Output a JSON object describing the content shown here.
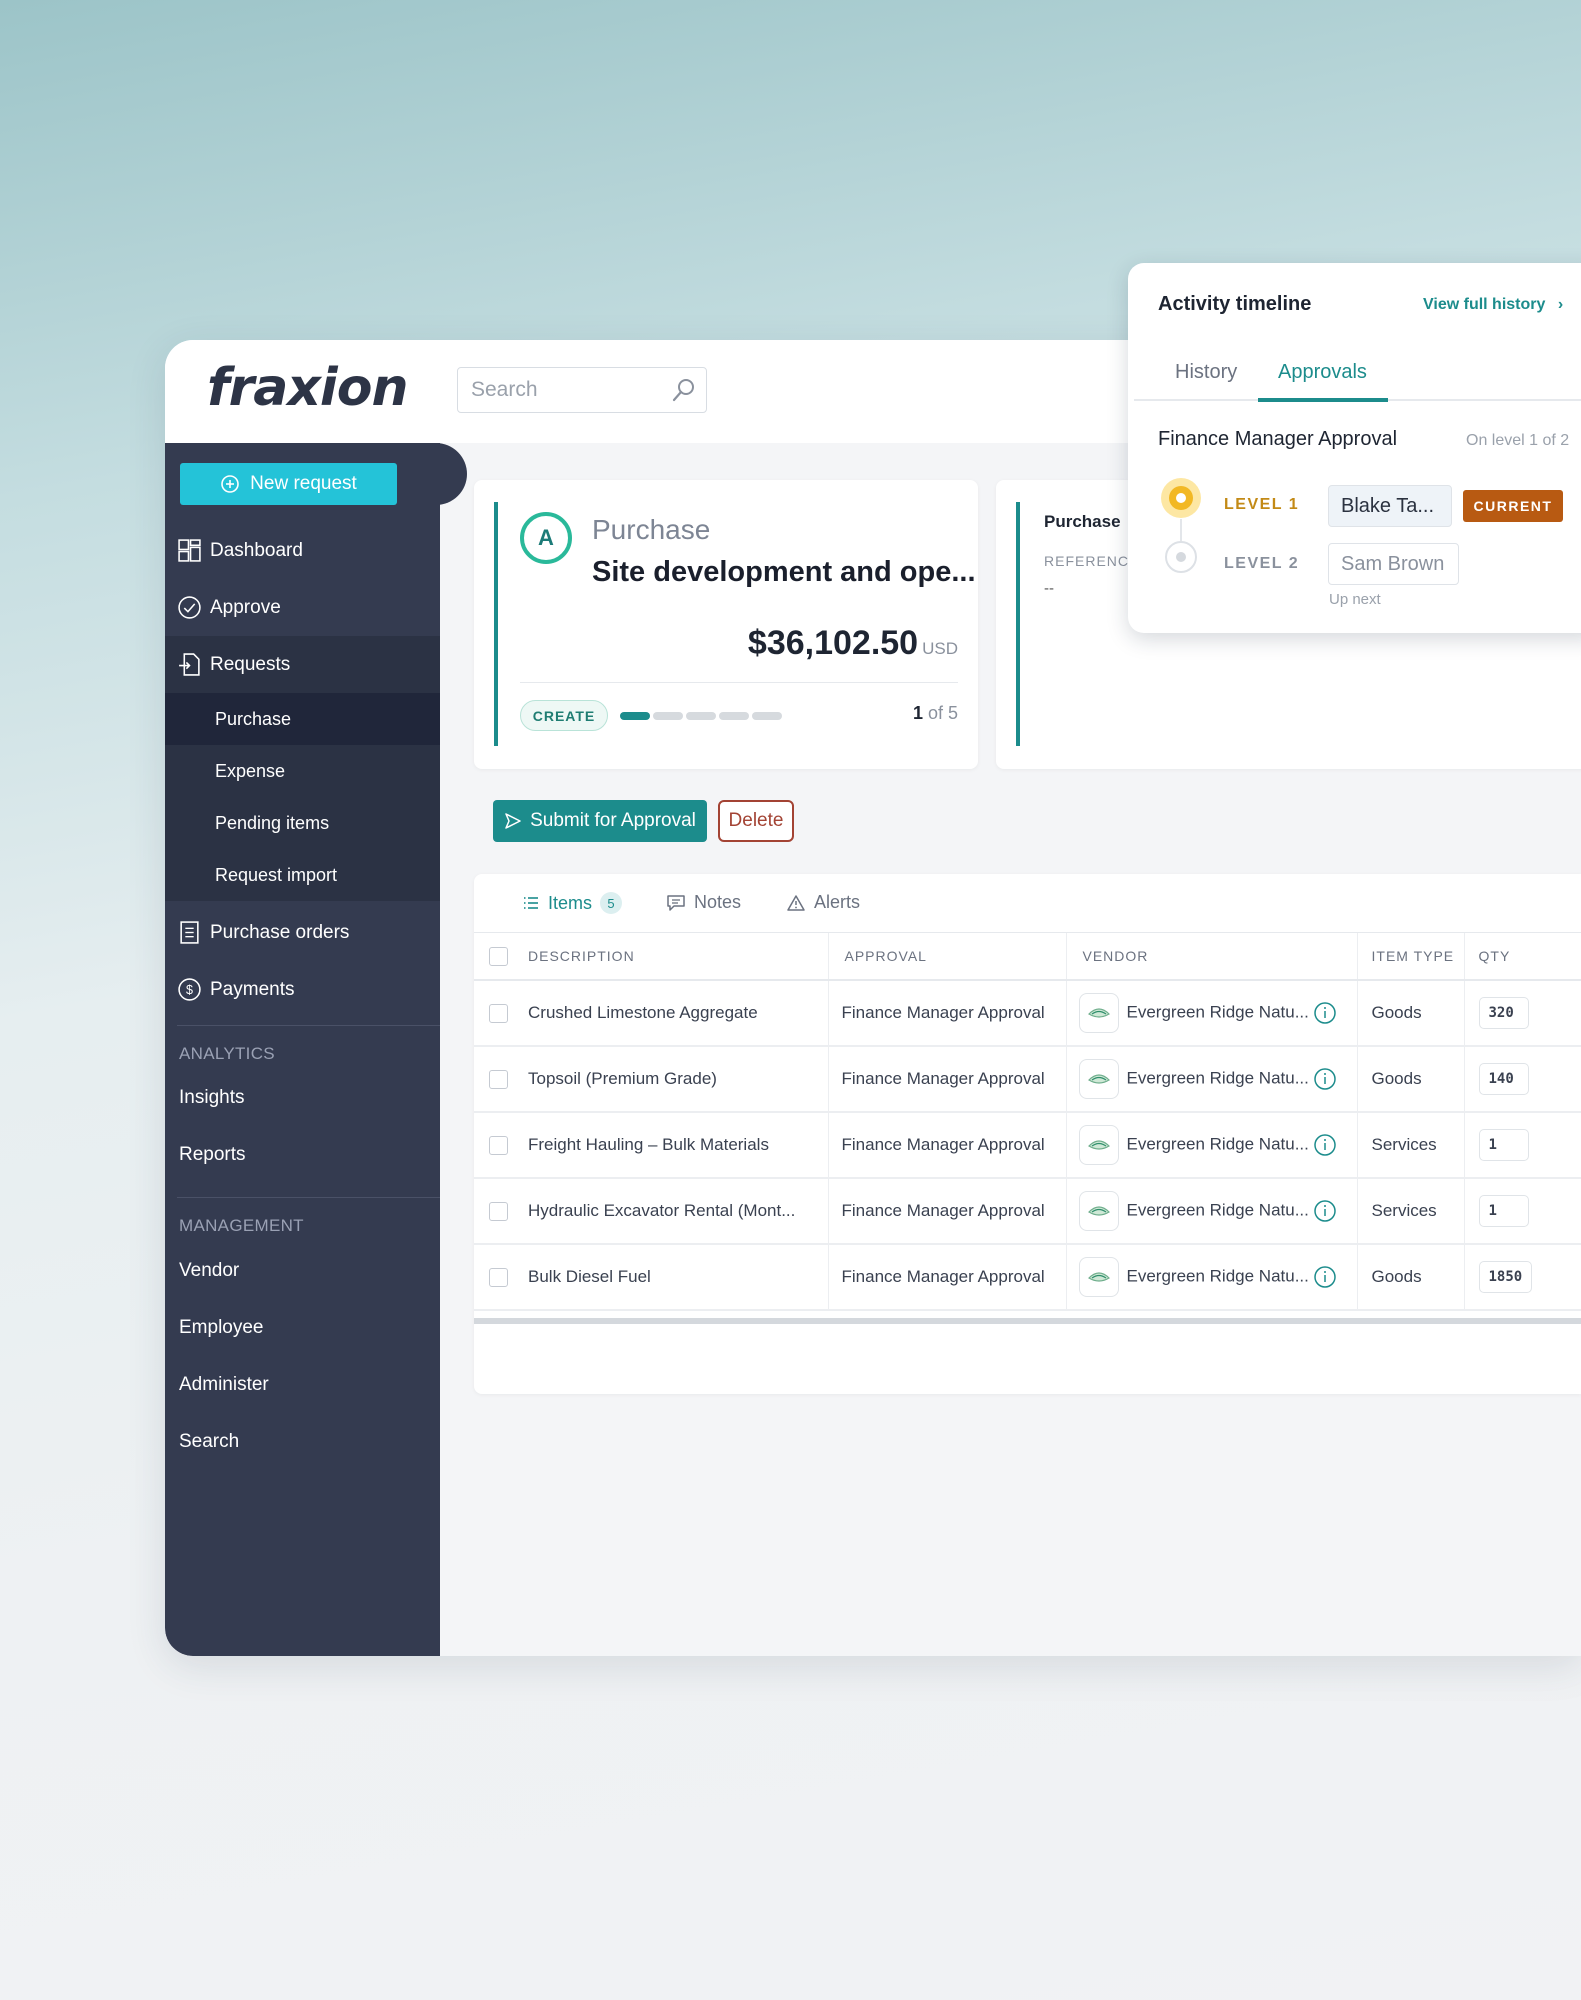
{
  "app": {
    "logo": "fraxion"
  },
  "search": {
    "placeholder": "Search"
  },
  "sidebar": {
    "new_request": "New request",
    "items": [
      {
        "label": "Dashboard",
        "icon": "dashboard-icon"
      },
      {
        "label": "Approve",
        "icon": "check-circle-icon"
      },
      {
        "label": "Requests",
        "icon": "requests-icon"
      }
    ],
    "sub_items": [
      "Purchase",
      "Expense",
      "Pending items",
      "Request import"
    ],
    "items_after": [
      {
        "label": "Purchase orders",
        "icon": "document-icon"
      },
      {
        "label": "Payments",
        "icon": "dollar-icon"
      }
    ],
    "analytics": {
      "heading": "ANALYTICS",
      "items": [
        "Insights",
        "Reports"
      ]
    },
    "management": {
      "heading": "MANAGEMENT",
      "items": [
        "Vendor",
        "Employee",
        "Administer",
        "Search"
      ]
    }
  },
  "request": {
    "avatar": "A",
    "type": "Purchase",
    "title": "Site development and ope...",
    "amount": "$36,102.50",
    "currency": "USD",
    "stage": "CREATE",
    "step_current": "1",
    "step_total_text": "of 5",
    "steps_total": 5,
    "steps_done": 1
  },
  "reference_card": {
    "title": "Purchase",
    "label": "REFERENCE",
    "value": "--"
  },
  "actions": {
    "submit": "Submit for Approval",
    "delete": "Delete"
  },
  "tabs": {
    "items": "Items",
    "items_count": "5",
    "notes": "Notes",
    "alerts": "Alerts"
  },
  "table": {
    "headers": {
      "description": "DESCRIPTION",
      "approval": "APPROVAL",
      "vendor": "VENDOR",
      "item_type": "ITEM TYPE",
      "qty": "QTY"
    },
    "rows": [
      {
        "description": "Crushed Limestone Aggregate",
        "approval": "Finance Manager Approval",
        "vendor": "Evergreen Ridge Natu...",
        "item_type": "Goods",
        "qty": "320"
      },
      {
        "description": "Topsoil (Premium Grade)",
        "approval": "Finance Manager Approval",
        "vendor": "Evergreen Ridge Natu...",
        "item_type": "Goods",
        "qty": "140"
      },
      {
        "description": "Freight Hauling – Bulk Materials",
        "approval": "Finance Manager Approval",
        "vendor": "Evergreen Ridge Natu...",
        "item_type": "Services",
        "qty": "1"
      },
      {
        "description": "Hydraulic Excavator Rental (Mont...",
        "approval": "Finance Manager Approval",
        "vendor": "Evergreen Ridge Natu...",
        "item_type": "Services",
        "qty": "1"
      },
      {
        "description": "Bulk Diesel Fuel",
        "approval": "Finance Manager Approval",
        "vendor": "Evergreen Ridge Natu...",
        "item_type": "Goods",
        "qty": "1850"
      }
    ]
  },
  "activity": {
    "title": "Activity timeline",
    "view_full": "View full history",
    "tabs": [
      "History",
      "Approvals"
    ],
    "group": "Finance Manager Approval",
    "level_info": "On level 1 of 2",
    "levels": [
      {
        "label": "LEVEL 1",
        "approver": "Blake Ta...",
        "badge": "CURRENT"
      },
      {
        "label": "LEVEL 2",
        "approver": "Sam Brown",
        "note": "Up next"
      }
    ]
  },
  "colors": {
    "accent": "#1c8c8c",
    "sidebar": "#343b50",
    "new_request": "#24c3d8",
    "current_badge": "#b85a12",
    "delete": "#a34334"
  }
}
